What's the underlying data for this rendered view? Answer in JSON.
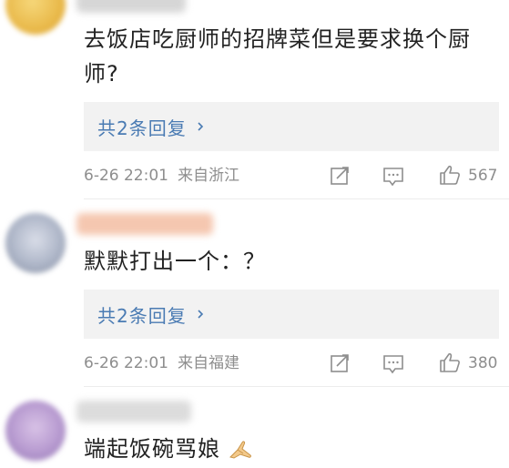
{
  "comments": [
    {
      "text": "去饭店吃厨师的招牌菜但是要求换个厨师?",
      "replies_label": "共2条回复",
      "date": "6-26 22:01",
      "source": "来自浙江",
      "likes": "567",
      "icons": [
        "share-icon",
        "comment-icon",
        "like-icon"
      ]
    },
    {
      "text": "默默打出一个：？",
      "replies_label": "共2条回复",
      "date": "6-26 22:01",
      "source": "来自福建",
      "likes": "380",
      "icons": [
        "share-icon",
        "comment-icon",
        "like-icon"
      ]
    },
    {
      "text": "端起饭碗骂娘",
      "emoji": "folded-hands-emoji"
    }
  ],
  "colors": {
    "link": "#4a7bb3",
    "meta": "#8e8e8e",
    "reply_bg": "#f2f2f2",
    "text": "#222222"
  }
}
